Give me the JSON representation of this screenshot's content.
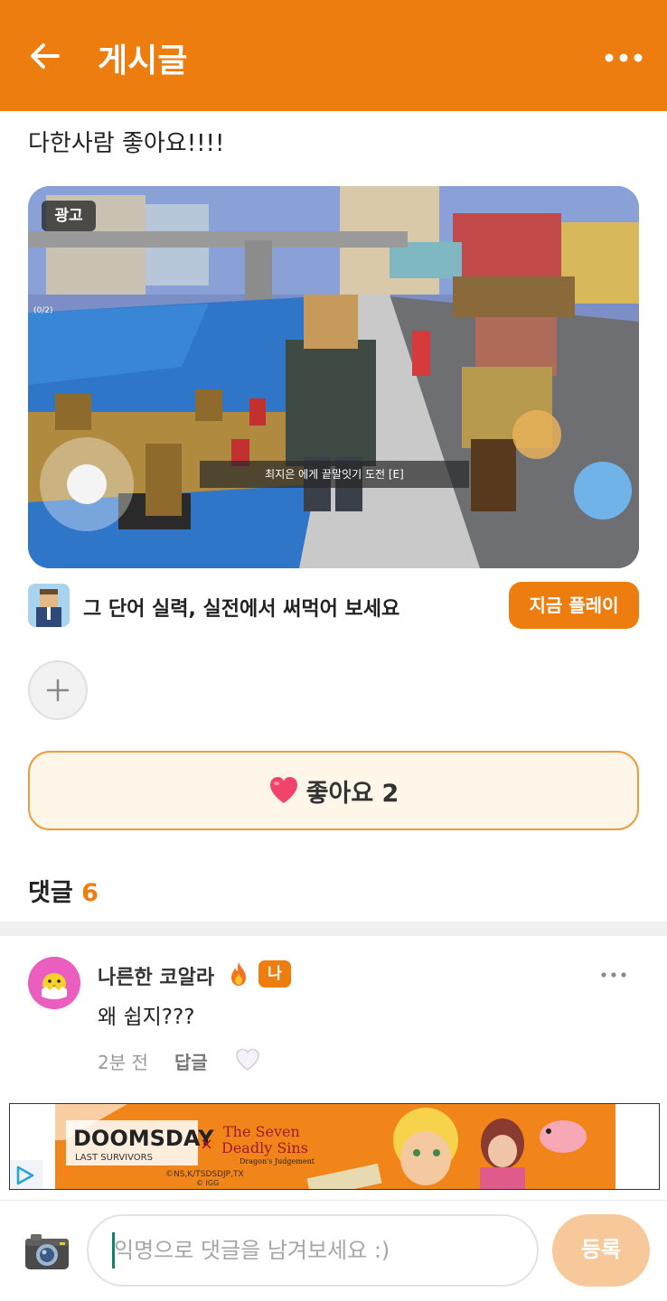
{
  "header": {
    "title": "게시글",
    "back_icon": "arrow-left-icon",
    "more_icon": "more-horizontal-icon",
    "background": "#ee7d0f"
  },
  "post": {
    "text": "다한사람 좋아요!!!!"
  },
  "ad": {
    "badge": "광고",
    "game_caption": "최지은 에게 끝말잇기 도전 [E]",
    "headline": "그 단어 실력, 실전에서 써먹어 보세요",
    "cta": "지금 플레이"
  },
  "actions": {
    "add_icon": "plus-icon"
  },
  "like": {
    "label": "좋아요 2",
    "icon": "heart-icon",
    "heart_color": "#f2436b"
  },
  "comments": {
    "title": "댓글",
    "count": "6",
    "items": [
      {
        "author": "나른한 코알라",
        "author_icon": "fire-icon",
        "me_badge": "나",
        "body": "왜 쉽지???",
        "time": "2분 전",
        "reply": "답글",
        "like_icon": "heart-outline-icon"
      }
    ]
  },
  "banner": {
    "icon": "adchoices-icon",
    "logo_text": "DOOMSDAY",
    "logo_sub": "LAST SURVIVORS",
    "cross": "×",
    "collab_title_1": "The Seven",
    "collab_title_2": "Deadly Sins",
    "collab_sub": "Dragon's Judgement",
    "copyright": "©NS,K/TSDSDJP,TX",
    "copyright2": "© IGG"
  },
  "composer": {
    "camera_icon": "camera-icon",
    "placeholder": "익명으로 댓글을 남겨보세요 :)",
    "submit": "등록"
  }
}
